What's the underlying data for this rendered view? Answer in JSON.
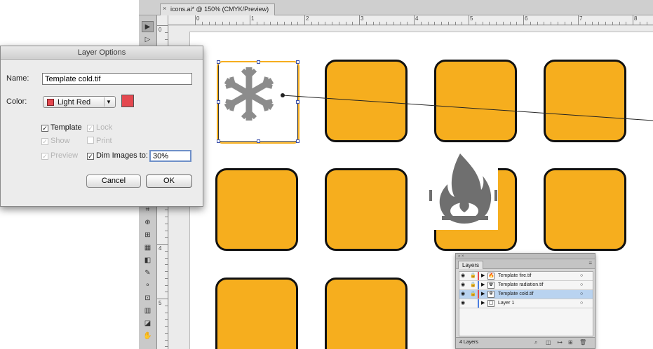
{
  "document": {
    "tab_title": "icons.ai* @ 150% (CMYK/Preview)",
    "close_glyph": "×"
  },
  "rulers": {
    "top_numbers": [
      "0",
      "1",
      "2",
      "3",
      "4",
      "5",
      "6",
      "7",
      "8"
    ],
    "left_numbers": [
      "0",
      "1",
      "2",
      "3",
      "4",
      "5"
    ]
  },
  "layer_options": {
    "title": "Layer Options",
    "name_label": "Name:",
    "name_value": "Template cold.tif",
    "color_label": "Color:",
    "color_value": "Light Red",
    "color_hex": "#e4484f",
    "template_label": "Template",
    "lock_label": "Lock",
    "show_label": "Show",
    "print_label": "Print",
    "preview_label": "Preview",
    "dim_label": "Dim Images to:",
    "dim_value": "30%",
    "cancel_label": "Cancel",
    "ok_label": "OK"
  },
  "layers_panel": {
    "title": "Layers",
    "count_label": "4 Layers",
    "layers": [
      {
        "name": "Template fire.tif",
        "color": "#e4484f",
        "selected": false,
        "thumb": "fire-icon"
      },
      {
        "name": "Template radiation.tif",
        "color": "#4a7de0",
        "selected": false,
        "thumb": "radiation-icon"
      },
      {
        "name": "Template cold.tif",
        "color": "#e4484f",
        "selected": true,
        "thumb": "snowflake-icon"
      },
      {
        "name": "Layer 1",
        "color": "#4a7de0",
        "selected": false,
        "thumb": "tile-icon"
      }
    ]
  },
  "colors": {
    "tile_orange": "#f6ae1e",
    "tile_border": "#111111",
    "selection_blue": "#3a4fa8"
  }
}
